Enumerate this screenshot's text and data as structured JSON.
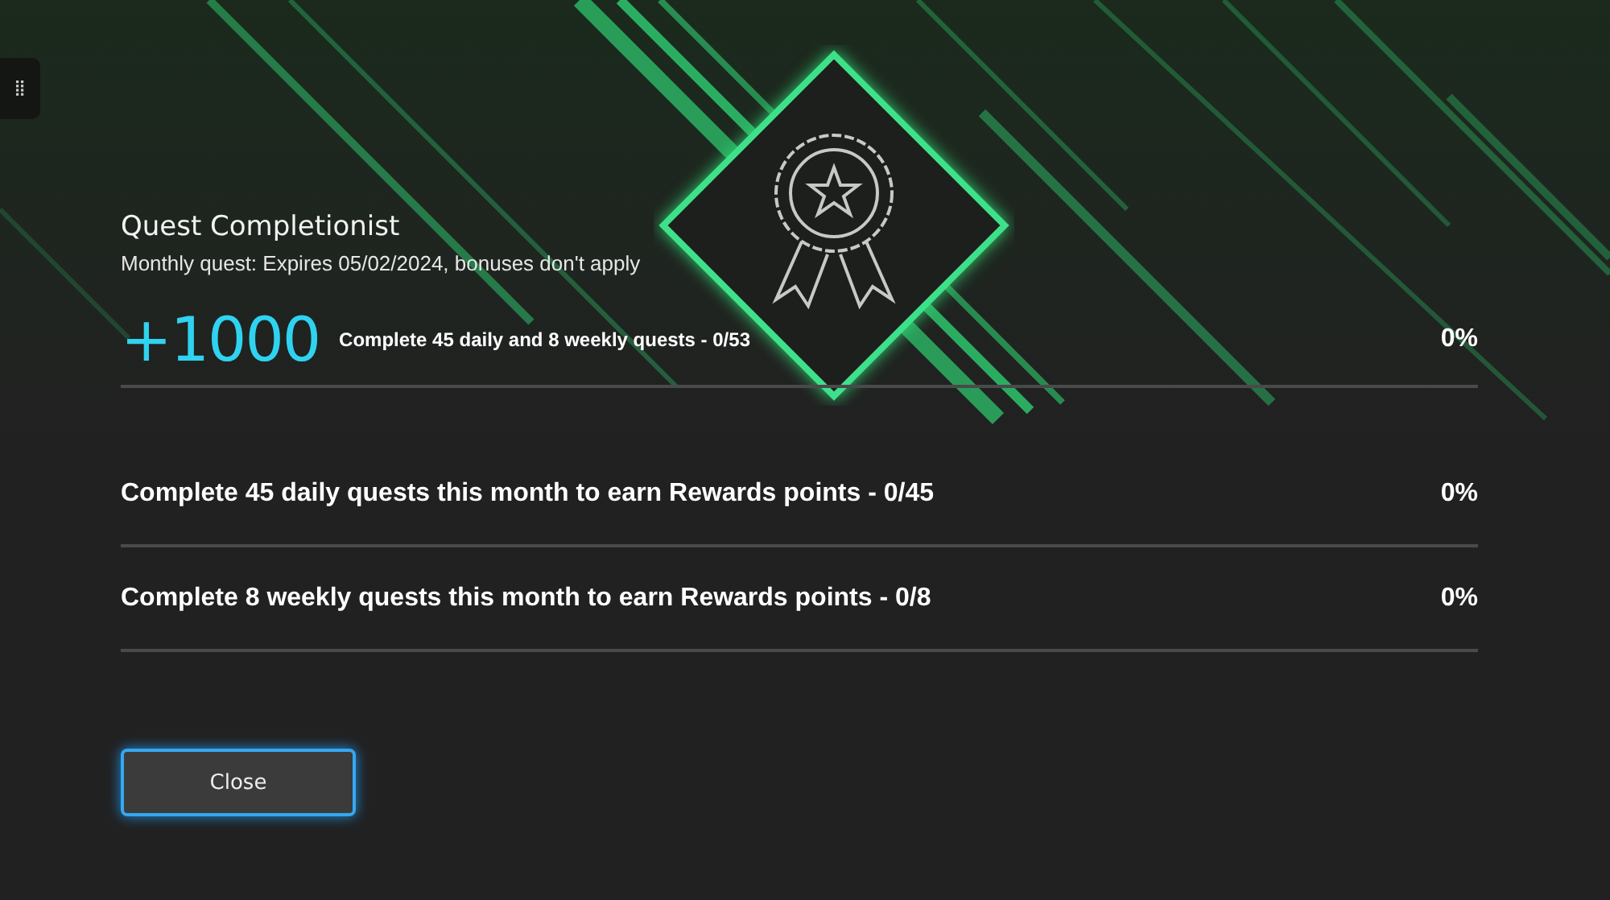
{
  "quest": {
    "title": "Quest Completionist",
    "subtitle": "Monthly quest: Expires 05/02/2024, bonuses don't apply",
    "reward": "+1000",
    "goal": "Complete 45 daily and 8 weekly quests - 0/53",
    "goal_percent": "0%"
  },
  "sub_quests": [
    {
      "text": "Complete 45 daily quests this month to earn Rewards points - 0/45",
      "percent": "0%"
    },
    {
      "text": "Complete 8 weekly quests this month to earn Rewards points - 0/8",
      "percent": "0%"
    }
  ],
  "buttons": [
    {
      "label": "Close",
      "focused": true
    }
  ]
}
